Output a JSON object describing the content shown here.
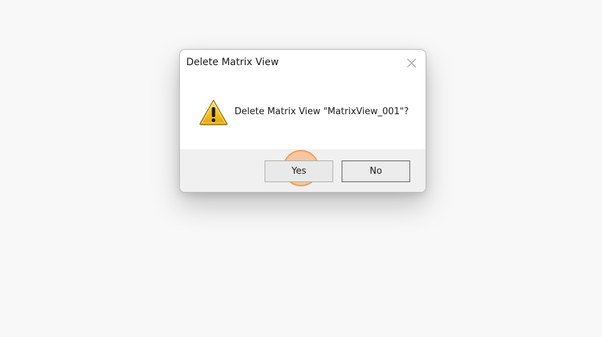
{
  "dialog": {
    "title": "Delete Matrix View",
    "message": "Delete Matrix View \"MatrixView_001\"?",
    "icon": "warning-icon",
    "buttons": {
      "yes_label": "Yes",
      "no_label": "No"
    },
    "close_icon": "close-icon"
  },
  "colors": {
    "page_background": "#f8f8f8",
    "dialog_background": "#ffffff",
    "footer_background": "#f0f0f0",
    "warning_fill": "#f4c21b",
    "click_indicator": "#f7a660"
  }
}
